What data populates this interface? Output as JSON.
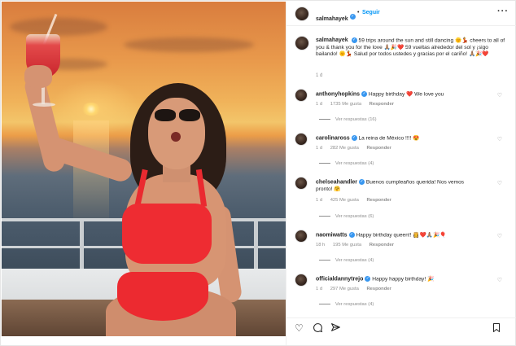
{
  "post": {
    "username": "salmahayek",
    "follow_label": "Seguir",
    "separator": "•",
    "more_label": "···",
    "caption_text": "59 trips around the sun and still dancing 🌞💃 cheers to all of you & thank you for the love 🙏🏽🎉❤️ 59 vueltas alrededor del sol y ¡sigo bailando! 🌞💃 Salud por todos ustedes y gracias por el cariño! 🙏🏽🎉❤️",
    "caption_time": "1 d"
  },
  "comments": [
    {
      "username": "anthonyhopkins",
      "text": "Happy birthday ❤️ We love you",
      "time": "1 d",
      "likes": "1735 Me gusta",
      "reply": "Responder",
      "replies": "Ver respuestas (16)"
    },
    {
      "username": "carolinaross",
      "text": "La reina de México !!!! 😍",
      "time": "1 d",
      "likes": "282 Me gusta",
      "reply": "Responder",
      "replies": "Ver respuestas (4)"
    },
    {
      "username": "chelseahandler",
      "text": "Buenos cumpleaños querida! Nos vemos pronto! 🤗",
      "time": "1 d",
      "likes": "425 Me gusta",
      "reply": "Responder",
      "replies": "Ver respuestas (6)"
    },
    {
      "username": "naomiwatts",
      "text": "Happy birthday queen!! 👸❤️🙏🏽🎉🎈",
      "time": "18 h",
      "likes": "195 Me gusta",
      "reply": "Responder",
      "replies": "Ver respuestas (4)"
    },
    {
      "username": "officialdannytrejo",
      "text": "Happy happy birthday! 🎉",
      "time": "1 d",
      "likes": "297 Me gusta",
      "reply": "Responder",
      "replies": "Ver respuestas (4)"
    }
  ],
  "icons": {
    "verified": "verified-badge-icon",
    "like": "heart-icon",
    "comment": "comment-icon",
    "share": "share-icon",
    "save": "bookmark-icon",
    "more": "more-options-icon"
  },
  "colors": {
    "accent": "#0095f6",
    "verified": "#3897f0",
    "muted": "#8e8e8e",
    "bikini": "#ee2c32"
  }
}
